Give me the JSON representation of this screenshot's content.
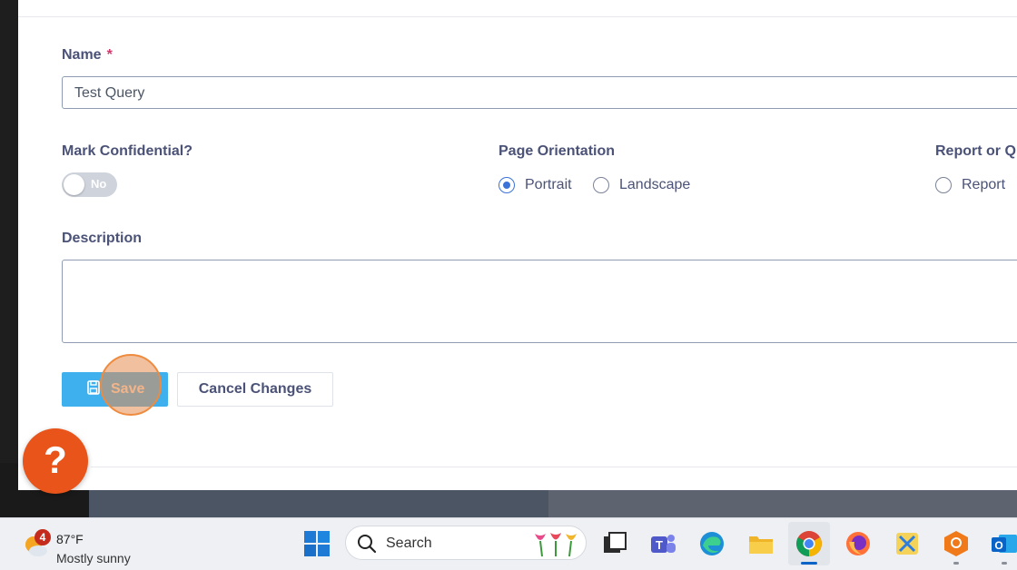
{
  "form": {
    "name_label": "Name",
    "name_required_mark": "*",
    "name_value": "Test Query",
    "confidential_label": "Mark Confidential?",
    "confidential_toggle_text": "No",
    "orientation_label": "Page Orientation",
    "orientation_options": [
      {
        "label": "Portrait",
        "selected": true
      },
      {
        "label": "Landscape",
        "selected": false
      }
    ],
    "report_or_query_label": "Report or Q",
    "report_option_label": "Report",
    "description_label": "Description",
    "description_value": "",
    "save_label": "Save",
    "cancel_label": "Cancel Changes"
  },
  "help_button": {
    "glyph": "?",
    "color": "#e8541a"
  },
  "taskbar": {
    "weather_badge": "4",
    "weather_temp": "87°F",
    "weather_condition": "Mostly sunny",
    "search_label": "Search",
    "apps": [
      "start-icon",
      "search",
      "task-view-icon",
      "teams-icon",
      "edge-icon",
      "file-explorer-icon",
      "chrome-icon",
      "firefox-icon",
      "snipping-tool-icon",
      "security-app-icon",
      "outlook-icon"
    ]
  },
  "colors": {
    "accent_blue": "#3fb0ee",
    "radio_blue": "#3b73d9",
    "label_text": "#4b5277",
    "required_red": "#d3386a",
    "click_highlight": "#ee8b3f"
  }
}
